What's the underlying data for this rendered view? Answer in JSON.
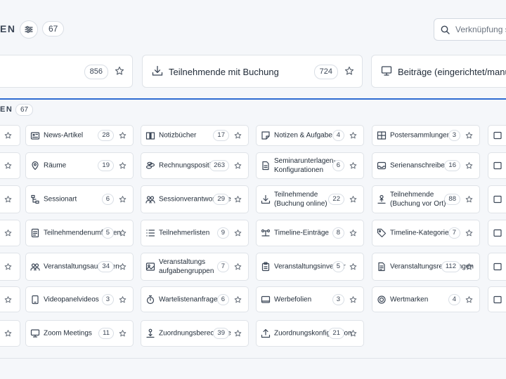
{
  "header": {
    "title": "EN",
    "count": "67",
    "search_placeholder": "Verknüpfung suchen"
  },
  "featured": [
    {
      "label": "",
      "count": "856",
      "icon": "none"
    },
    {
      "label": "Teilnehmende mit Buchung",
      "count": "724",
      "icon": "download-icon"
    },
    {
      "label": "Beiträge (eingerichtet/manuell)",
      "count": "",
      "icon": "monitor-icon"
    }
  ],
  "section": {
    "title": "EN",
    "count": "67"
  },
  "items": [
    {
      "label": "News-Artikel",
      "count": "28",
      "icon": "newspaper-icon"
    },
    {
      "label": "Notizbücher",
      "count": "17",
      "icon": "book-icon"
    },
    {
      "label": "Notizen & Aufgaben",
      "count": "4",
      "icon": "note-icon"
    },
    {
      "label": "Postersammlungen",
      "count": "3",
      "icon": "poster-icon"
    },
    {
      "label": "Räume",
      "count": "19",
      "icon": "pin-icon"
    },
    {
      "label": "Rechnungspositionen",
      "count": "263",
      "icon": "coins-icon"
    },
    {
      "label": "Seminarunterlagen-",
      "label2": "Konfigurationen",
      "count": "6",
      "icon": "document-icon"
    },
    {
      "label": "Serienanschreiben",
      "count": "16",
      "icon": "inbox-icon"
    },
    {
      "label": "Sessionart",
      "count": "6",
      "icon": "hierarchy-icon"
    },
    {
      "label": "Sessionverantwortliche",
      "count": "29",
      "icon": "users-icon"
    },
    {
      "label": "Teilnehmende",
      "label2": "(Buchung online)",
      "count": "22",
      "icon": "download-icon"
    },
    {
      "label": "Teilnehmende",
      "label2": "(Buchung vor Ort)",
      "count": "88",
      "icon": "person-upload-icon"
    },
    {
      "label": "Teilnehmendenumfragen",
      "count": "5",
      "icon": "form-icon"
    },
    {
      "label": "Teilnehmerlisten",
      "count": "9",
      "icon": "list-icon"
    },
    {
      "label": "Timeline-Einträge",
      "count": "8",
      "icon": "timeline-icon"
    },
    {
      "label": "Timeline-Kategorien",
      "count": "7",
      "icon": "tag-icon"
    },
    {
      "label": "Veranstaltungsaufgaben",
      "count": "34",
      "icon": "users-icon"
    },
    {
      "label": "Veranstaltungs",
      "label2": "aufgabengruppen",
      "count": "7",
      "icon": "image-icon"
    },
    {
      "label": "Veranstaltungsinventar",
      "count": "5",
      "icon": "clipboard-icon"
    },
    {
      "label": "Veranstaltungsrechnungen",
      "count": "112",
      "icon": "invoice-icon"
    },
    {
      "label": "Videopanelvideos",
      "count": "3",
      "icon": "tablet-icon"
    },
    {
      "label": "Wartelistenanfragen",
      "count": "6",
      "icon": "stopwatch-icon"
    },
    {
      "label": "Werbefolien",
      "count": "3",
      "icon": "slides-icon"
    },
    {
      "label": "Wertmarken",
      "count": "4",
      "icon": "token-icon"
    },
    {
      "label": "Zoom Meetings",
      "count": "11",
      "icon": "screen-icon"
    },
    {
      "label": "Zuordnungsberechtigte",
      "count": "39",
      "icon": "person-download-icon"
    },
    {
      "label": "Zuordnungskonfiguration",
      "count": "21",
      "icon": "upload-icon"
    }
  ],
  "colors": {
    "accent": "#2f6bd1",
    "border": "#dfe3e8",
    "background": "#f5f7fa"
  }
}
